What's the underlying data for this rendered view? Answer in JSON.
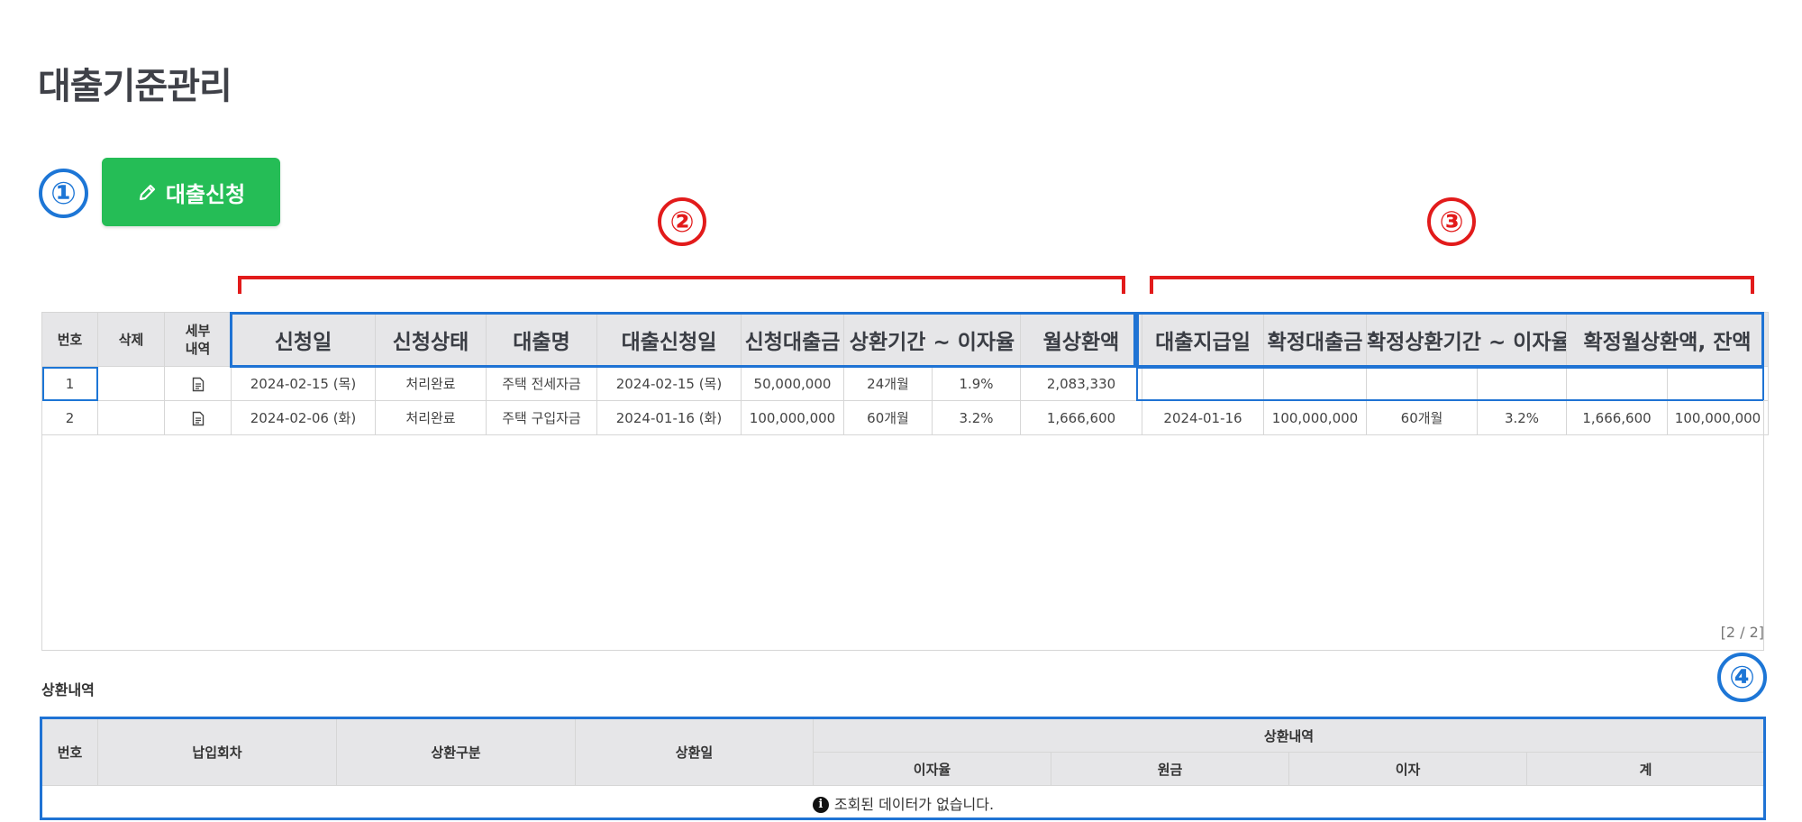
{
  "page": {
    "title": "대출기준관리"
  },
  "markers": [
    "①",
    "②",
    "③",
    "④"
  ],
  "toolbar": {
    "apply_label": "대출신청"
  },
  "loan_table": {
    "headers": {
      "no": "번호",
      "delete": "삭제",
      "detail": "세부\n내역",
      "apply_date": "신청일",
      "apply_status": "신청상태",
      "loan_name": "대출명",
      "loan_apply_date": "대출신청일",
      "apply_amount": "신청대출금",
      "period_rate": "상환기간 ~ 이자율",
      "monthly_payment": "월상환액",
      "disburse_date": "대출지급일",
      "confirmed_amount": "확정대출금",
      "confirmed_period_rate": "확정상환기간 ~ 이자율",
      "confirmed_monthly_balance": "확정월상환액, 잔액"
    },
    "rows": [
      {
        "no": "1",
        "apply_date": "2024-02-15 (목)",
        "status": "처리완료",
        "loan_name": "주택 전세자금",
        "loan_apply_date": "2024-02-15 (목)",
        "amount": "50,000,000",
        "period": "24개월",
        "rate": "1.9%",
        "monthly": "2,083,330",
        "disburse_date": "",
        "confirmed_amount": "",
        "confirmed_period": "",
        "confirmed_rate": "",
        "confirmed_monthly": "",
        "balance": ""
      },
      {
        "no": "2",
        "apply_date": "2024-02-06 (화)",
        "status": "처리완료",
        "loan_name": "주택 구입자금",
        "loan_apply_date": "2024-01-16 (화)",
        "amount": "100,000,000",
        "period": "60개월",
        "rate": "3.2%",
        "monthly": "1,666,600",
        "disburse_date": "2024-01-16",
        "confirmed_amount": "100,000,000",
        "confirmed_period": "60개월",
        "confirmed_rate": "3.2%",
        "confirmed_monthly": "1,666,600",
        "balance": "100,000,000"
      }
    ],
    "pager": "[2 / 2]"
  },
  "repayment": {
    "title": "상환내역",
    "headers": {
      "no": "번호",
      "installment": "납입회차",
      "type": "상환구분",
      "date": "상환일",
      "group": "상환내역",
      "rate": "이자율",
      "principal": "원금",
      "interest": "이자",
      "total": "계"
    },
    "empty_message": "조회된 데이터가 없습니다."
  },
  "colors": {
    "accent_green": "#25bd56",
    "highlight_blue": "#1f73d4",
    "annotation_red": "#e21b1b",
    "header_bg": "#e6e6e8"
  },
  "icons": {
    "apply": "pencil-icon",
    "detail": "document-icon",
    "empty": "info-icon"
  }
}
